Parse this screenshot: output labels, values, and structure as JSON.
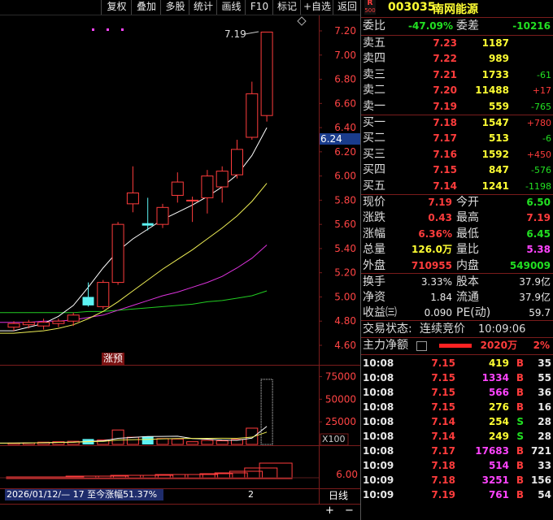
{
  "toolbar": [
    "复权",
    "叠加",
    "多股",
    "统计",
    "画线",
    "F10",
    "标记",
    "+自选",
    "返回"
  ],
  "header": {
    "badge_top": "R",
    "badge_bottom": "500",
    "code": "003035",
    "name": "南网能源"
  },
  "commission": {
    "ratio_label": "委比",
    "ratio": "-47.09%",
    "diff_label": "委差",
    "diff": "-10216"
  },
  "asks": [
    {
      "label": "卖五",
      "price": "7.23",
      "vol": "1187",
      "chg": ""
    },
    {
      "label": "卖四",
      "price": "7.22",
      "vol": "989",
      "chg": ""
    },
    {
      "label": "卖三",
      "price": "7.21",
      "vol": "1733",
      "chg": "-61"
    },
    {
      "label": "卖二",
      "price": "7.20",
      "vol": "11488",
      "chg": "+17"
    },
    {
      "label": "卖一",
      "price": "7.19",
      "vol": "559",
      "chg": "-765"
    }
  ],
  "bids": [
    {
      "label": "买一",
      "price": "7.18",
      "vol": "1547",
      "chg": "+780"
    },
    {
      "label": "买二",
      "price": "7.17",
      "vol": "513",
      "chg": "-6"
    },
    {
      "label": "买三",
      "price": "7.16",
      "vol": "1592",
      "chg": "+450"
    },
    {
      "label": "买四",
      "price": "7.15",
      "vol": "847",
      "chg": "-576"
    },
    {
      "label": "买五",
      "price": "7.14",
      "vol": "1241",
      "chg": "-1198"
    }
  ],
  "quote": [
    {
      "l1": "现价",
      "v1": "7.19",
      "l2": "今开",
      "v2": "6.50"
    },
    {
      "l1": "涨跌",
      "v1": "0.43",
      "l2": "最高",
      "v2": "7.19"
    },
    {
      "l1": "涨幅",
      "v1": "6.36%",
      "l2": "最低",
      "v2": "6.45"
    },
    {
      "l1": "总量",
      "v1": "126.0万",
      "l2": "量比",
      "v2": "5.38"
    },
    {
      "l1": "外盘",
      "v1": "710955",
      "l2": "内盘",
      "v2": "549009"
    }
  ],
  "stats": [
    {
      "l1": "换手",
      "v1": "3.33%",
      "l2": "股本",
      "v2": "37.9亿"
    },
    {
      "l1": "净资",
      "v1": "1.84",
      "l2": "流通",
      "v2": "37.9亿"
    },
    {
      "l1": "收益㈢",
      "v1": "0.090",
      "l2": "PE(动)",
      "v2": "59.7"
    }
  ],
  "status": {
    "label": "交易状态:",
    "value": "连续竞价",
    "time": "10:09:06"
  },
  "mainflow": {
    "label": "主力净额",
    "value": "2020万",
    "pct": "2%"
  },
  "trades": [
    {
      "t": "10:08",
      "p": "7.15",
      "v": "419",
      "s": "B",
      "n": "35"
    },
    {
      "t": "10:08",
      "p": "7.15",
      "v": "1334",
      "s": "B",
      "n": "55"
    },
    {
      "t": "10:08",
      "p": "7.15",
      "v": "566",
      "s": "B",
      "n": "36"
    },
    {
      "t": "10:08",
      "p": "7.15",
      "v": "276",
      "s": "B",
      "n": "16"
    },
    {
      "t": "10:08",
      "p": "7.14",
      "v": "254",
      "s": "S",
      "n": "28"
    },
    {
      "t": "10:08",
      "p": "7.14",
      "v": "249",
      "s": "S",
      "n": "28"
    },
    {
      "t": "10:08",
      "p": "7.17",
      "v": "17683",
      "s": "B",
      "n": "721"
    },
    {
      "t": "10:09",
      "p": "7.18",
      "v": "514",
      "s": "B",
      "n": "33"
    },
    {
      "t": "10:09",
      "p": "7.18",
      "v": "3251",
      "s": "B",
      "n": "156"
    },
    {
      "t": "10:09",
      "p": "7.19",
      "v": "761",
      "s": "B",
      "n": "54"
    }
  ],
  "chart_labels": {
    "high_label": "7.19",
    "cursor_price": "6.24",
    "limit_tag": "涨预",
    "x100": "X100",
    "vol_ticks": [
      "75000",
      "50000",
      "25000"
    ],
    "macd_tick": "6.00",
    "bottom_info": "2026/01/12/— 17 至今涨幅51.37%",
    "bottom_mark": "2",
    "period": "日线",
    "plus": "+",
    "minus": "−"
  },
  "chart_data": {
    "type": "candlestick",
    "y_ticks": [
      "7.20",
      "7.00",
      "6.80",
      "6.60",
      "6.40",
      "6.20",
      "6.00",
      "5.80",
      "5.60",
      "5.40",
      "5.20",
      "5.00",
      "4.80",
      "4.60"
    ],
    "ylim": [
      4.55,
      7.26
    ],
    "candles": [
      {
        "o": 4.75,
        "c": 4.78,
        "h": 4.8,
        "l": 4.72
      },
      {
        "o": 4.77,
        "c": 4.79,
        "h": 4.81,
        "l": 4.74
      },
      {
        "o": 4.76,
        "c": 4.79,
        "h": 4.82,
        "l": 4.73
      },
      {
        "o": 4.78,
        "c": 4.8,
        "h": 4.82,
        "l": 4.75
      },
      {
        "o": 4.8,
        "c": 4.85,
        "h": 4.87,
        "l": 4.76
      },
      {
        "o": 4.93,
        "c": 5.0,
        "h": 5.12,
        "l": 4.92,
        "flat": true
      },
      {
        "o": 4.92,
        "c": 5.12,
        "h": 5.14,
        "l": 4.9
      },
      {
        "o": 5.12,
        "c": 5.6,
        "h": 5.62,
        "l": 5.1
      },
      {
        "o": 5.77,
        "c": 5.86,
        "h": 6.08,
        "l": 5.7
      },
      {
        "o": 5.59,
        "c": 5.61,
        "h": 5.82,
        "l": 5.55,
        "flat": true
      },
      {
        "o": 5.6,
        "c": 5.74,
        "h": 5.77,
        "l": 5.57
      },
      {
        "o": 5.84,
        "c": 5.95,
        "h": 6.03,
        "l": 5.78
      },
      {
        "o": 5.8,
        "c": 5.8,
        "h": 5.83,
        "l": 5.62
      },
      {
        "o": 5.82,
        "c": 6.0,
        "h": 6.05,
        "l": 5.69
      },
      {
        "o": 5.91,
        "c": 6.04,
        "h": 6.08,
        "l": 5.78
      },
      {
        "o": 6.01,
        "c": 6.22,
        "h": 6.3,
        "l": 5.98
      },
      {
        "o": 6.32,
        "c": 6.68,
        "h": 6.78,
        "l": 6.3
      },
      {
        "o": 6.5,
        "c": 7.19,
        "h": 7.19,
        "l": 6.45
      }
    ],
    "ma_white": [
      4.72,
      4.75,
      4.78,
      4.84,
      4.93,
      5.08,
      5.24,
      5.38,
      5.48,
      5.56,
      5.64,
      5.7,
      5.76,
      5.83,
      5.91,
      6.01,
      6.17,
      6.4
    ],
    "ma_yellow": [
      4.7,
      4.71,
      4.72,
      4.74,
      4.77,
      4.82,
      4.88,
      4.96,
      5.05,
      5.14,
      5.23,
      5.31,
      5.39,
      5.48,
      5.57,
      5.67,
      5.79,
      5.94
    ],
    "ma_magenta": [
      4.79,
      4.79,
      4.8,
      4.8,
      4.81,
      4.83,
      4.85,
      4.89,
      4.93,
      4.97,
      5.01,
      5.04,
      5.08,
      5.12,
      5.17,
      5.24,
      5.32,
      5.43
    ],
    "ma_green": [
      4.87,
      4.87,
      4.87,
      4.87,
      4.87,
      4.88,
      4.88,
      4.89,
      4.9,
      4.91,
      4.92,
      4.93,
      4.94,
      4.96,
      4.97,
      4.99,
      5.01,
      5.05
    ],
    "volume": [
      1500,
      1800,
      2500,
      3000,
      3500,
      6000,
      5000,
      16000,
      8000,
      9000,
      6500,
      6000,
      3000,
      4500,
      4000,
      5500,
      18000,
      72000
    ],
    "vol_ylim": [
      0,
      80000
    ]
  }
}
